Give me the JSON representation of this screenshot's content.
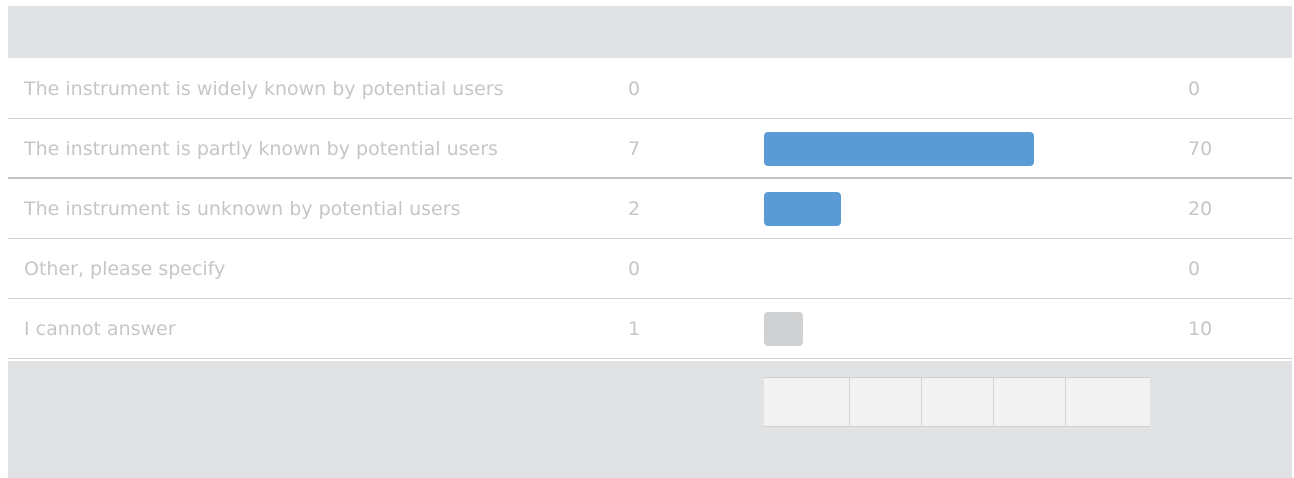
{
  "chart_data": {
    "type": "bar",
    "orientation": "horizontal",
    "columns": [
      "label",
      "count",
      "percent"
    ],
    "rows": [
      {
        "label": "The instrument is widely known by potential users",
        "count": "0",
        "percent": "0",
        "value": 0,
        "color": "#5b9bd5"
      },
      {
        "label": "The instrument is partly known by potential users",
        "count": "7",
        "percent": "70",
        "value": 70,
        "color": "#5b9bd5"
      },
      {
        "label": "The instrument is unknown by potential users",
        "count": "2",
        "percent": "20",
        "value": 20,
        "color": "#5b9bd5"
      },
      {
        "label": "Other, please specify",
        "count": "0",
        "percent": "0",
        "value": 0,
        "color": "#5b9bd5"
      },
      {
        "label": "I cannot answer",
        "count": "1",
        "percent": "10",
        "value": 10,
        "color": "#d0d1d2"
      }
    ],
    "xlim": [
      0,
      100
    ],
    "grid": true,
    "title": "",
    "xlabel": "",
    "ylabel": ""
  },
  "colors": {
    "bar": "#5b9bd5",
    "bar_no_answer": "#d0d1d2",
    "band": "#e1e2e3",
    "text": "#c6c6c6"
  }
}
